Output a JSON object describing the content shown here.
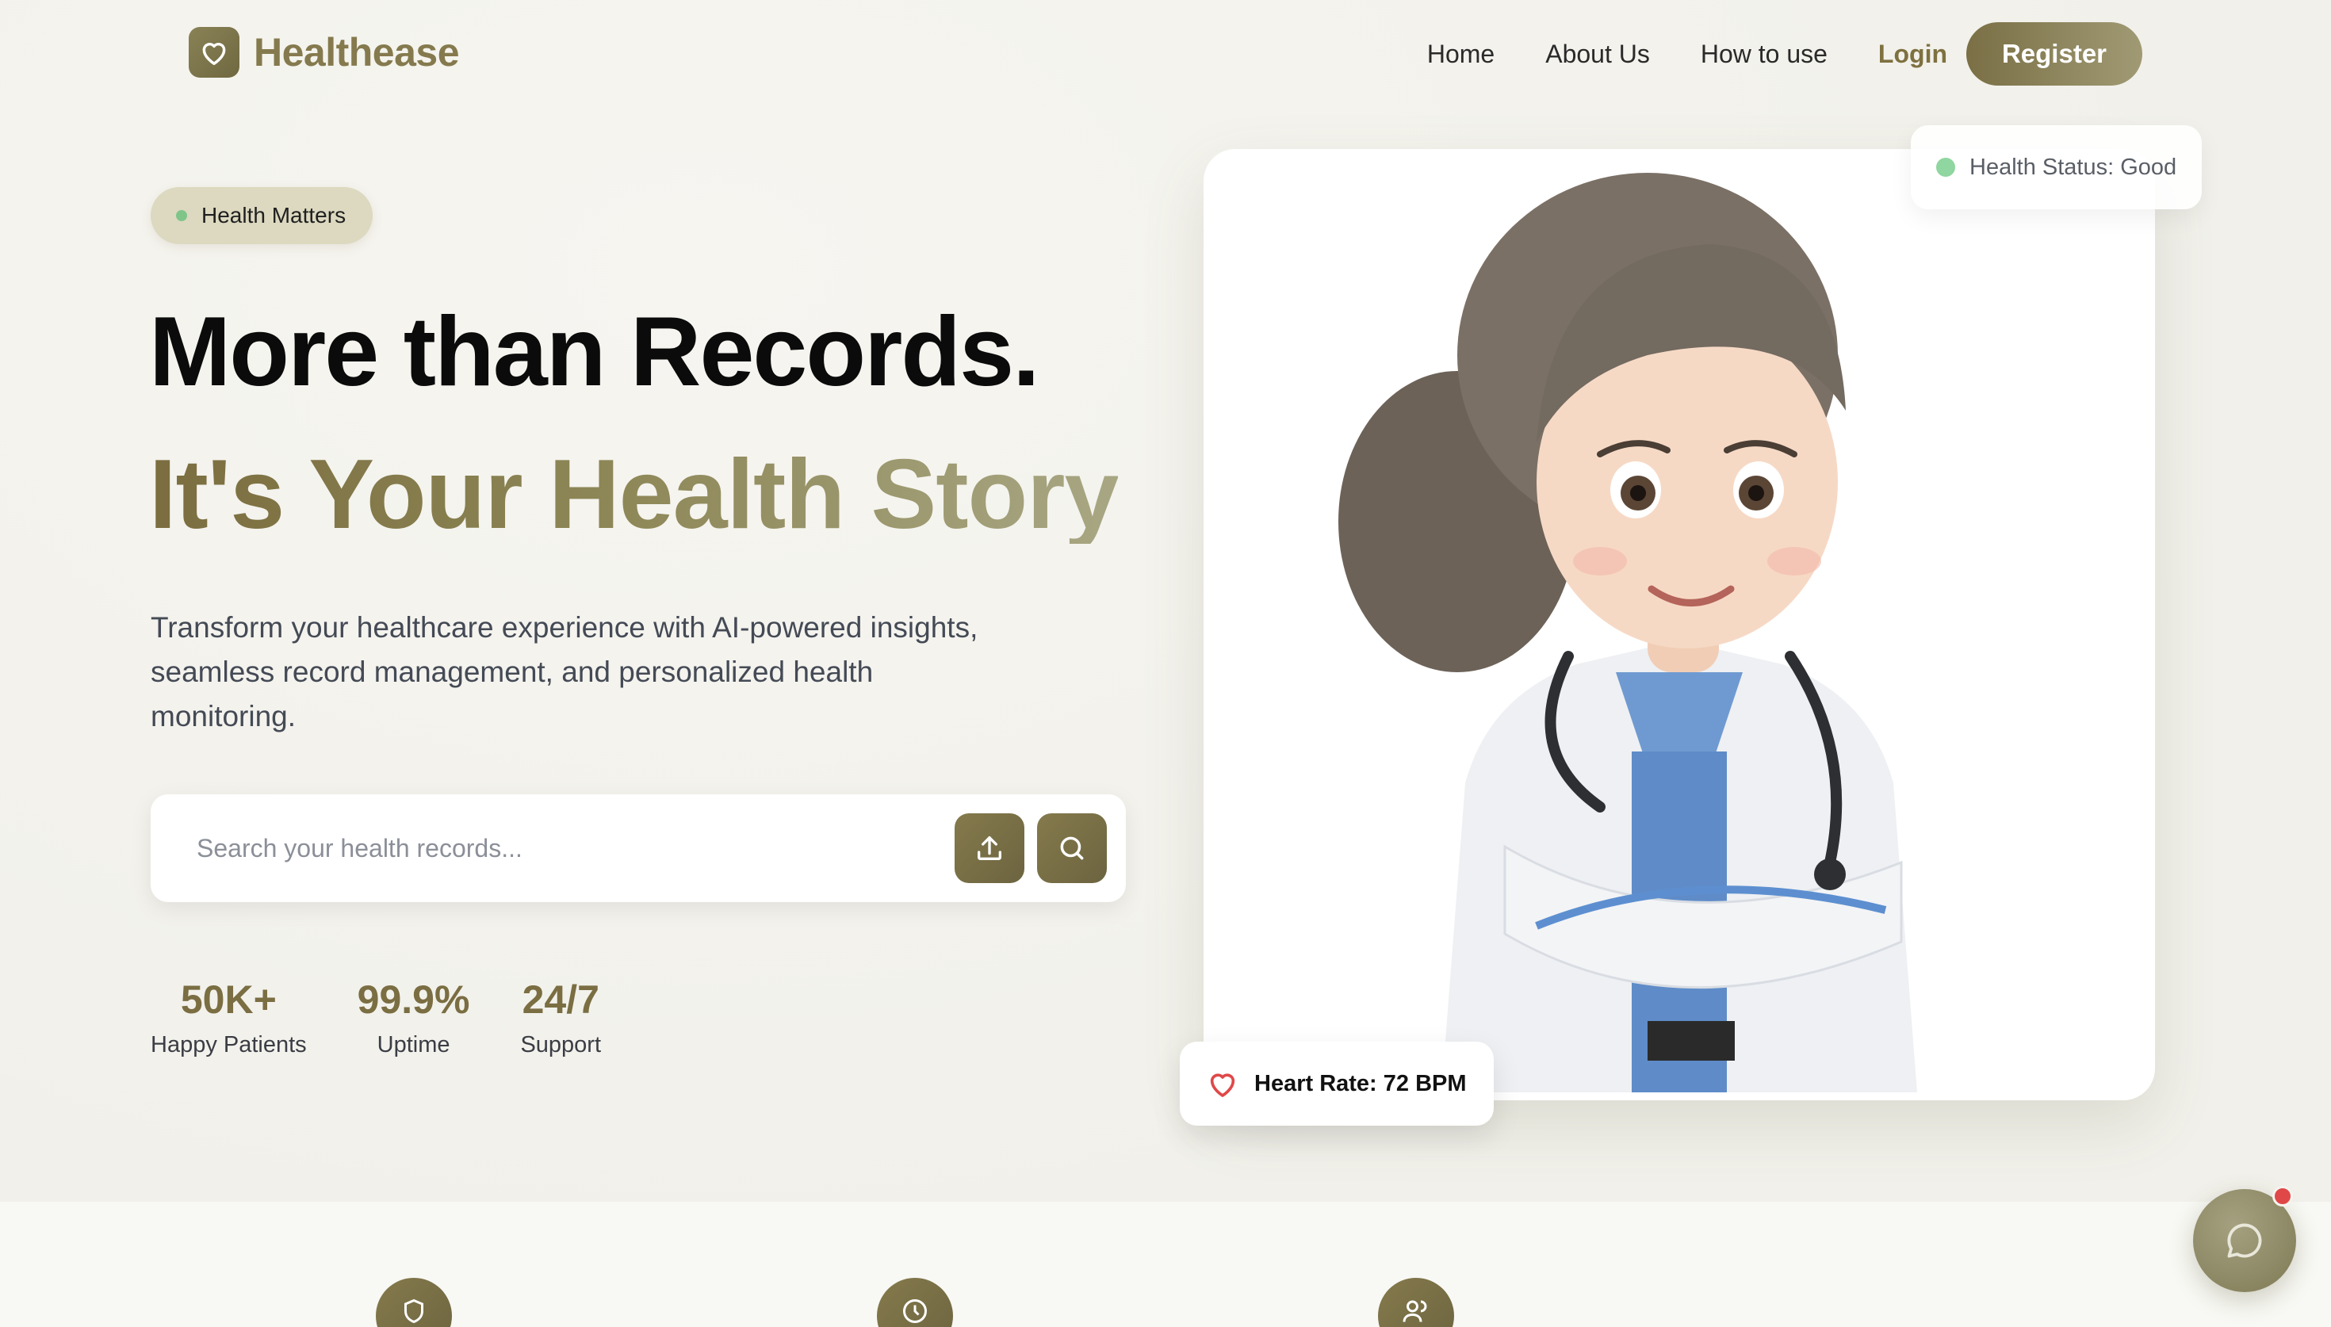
{
  "brand": {
    "name": "Healthease"
  },
  "nav": {
    "home": "Home",
    "about": "About Us",
    "how": "How to use",
    "login": "Login",
    "register": "Register"
  },
  "hero": {
    "badge": "Health Matters",
    "title_line1": "More than Records.",
    "title_line2": "It's Your Health Story",
    "description": "Transform your healthcare experience with AI-powered insights, seamless record management, and personalized health monitoring."
  },
  "search": {
    "placeholder": "Search your health records..."
  },
  "stats": [
    {
      "value": "50K+",
      "label": "Happy Patients"
    },
    {
      "value": "99.9%",
      "label": "Uptime"
    },
    {
      "value": "24/7",
      "label": "Support"
    }
  ],
  "card": {
    "status": "Health Status: Good",
    "heart_rate": "Heart Rate: 72 BPM"
  },
  "features": {
    "icons": [
      "shield-icon",
      "clock-icon",
      "users-icon"
    ]
  },
  "colors": {
    "accent": "#7a6e42",
    "accent_light": "#a8a783",
    "badge_bg": "#dcd9c0",
    "status_green": "#8fd6a0",
    "alert_red": "#e04848"
  }
}
